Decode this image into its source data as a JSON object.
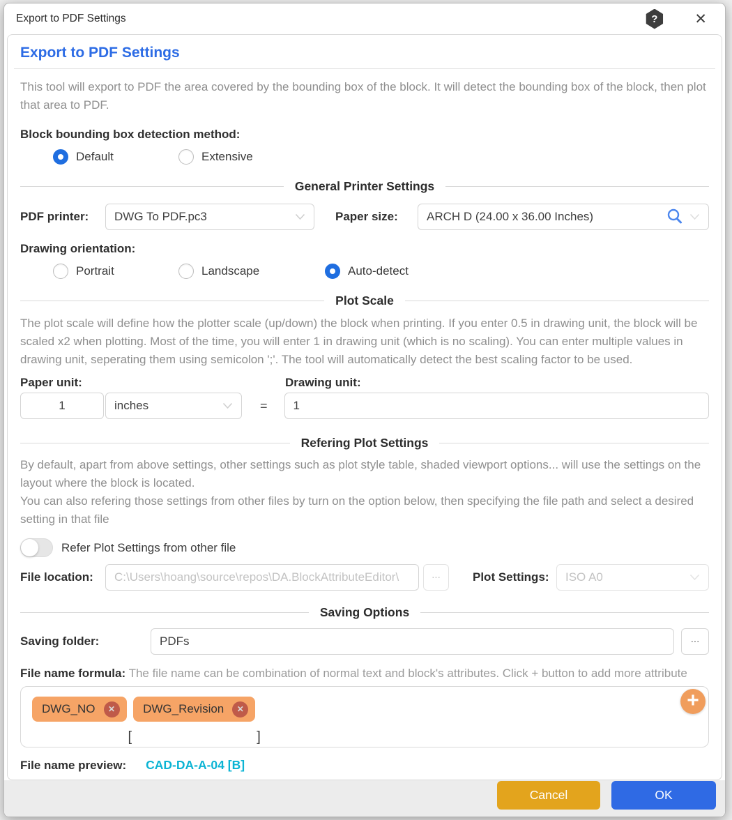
{
  "window": {
    "title": "Export to PDF Settings"
  },
  "header": {
    "title": "Export to PDF Settings"
  },
  "intro_text": "This tool will export to PDF the area covered by the bounding box of the block. It will detect the bounding box of the block, then plot that area to PDF.",
  "detection": {
    "label": "Block bounding box detection method:",
    "options": [
      {
        "label": "Default",
        "selected": true
      },
      {
        "label": "Extensive",
        "selected": false
      }
    ]
  },
  "printer_section": {
    "title": "General Printer Settings",
    "pdf_printer_label": "PDF printer:",
    "pdf_printer_value": "DWG To PDF.pc3",
    "paper_size_label": "Paper size:",
    "paper_size_value": "ARCH D (24.00 x 36.00 Inches)",
    "orientation_label": "Drawing orientation:",
    "orientation_options": [
      {
        "label": "Portrait",
        "selected": false
      },
      {
        "label": "Landscape",
        "selected": false
      },
      {
        "label": "Auto-detect",
        "selected": true
      }
    ]
  },
  "plot_scale": {
    "title": "Plot Scale",
    "description": "The plot scale will define how the plotter scale (up/down) the block when printing. If you enter 0.5 in drawing unit, the block will be scaled x2 when plotting. Most of the time, you will enter 1 in drawing unit (which is no scaling). You can enter multiple values in drawing unit, seperating them using semicolon ';'. The tool will automatically detect the best scaling factor to be used.",
    "paper_unit_label": "Paper unit:",
    "paper_unit_value": "1",
    "paper_unit_kind": "inches",
    "equals_sign": "=",
    "drawing_unit_label": "Drawing unit:",
    "drawing_unit_value": "1"
  },
  "refering_section": {
    "title": "Refering Plot Settings",
    "description1": "By default, apart from above settings, other settings such as plot style table, shaded viewport options... will use the settings on the layout where the block is located.",
    "description2": "You can also refering those settings from other files by turn on the option below, then specifying the file path and select a desired setting in that file",
    "toggle_label": "Refer Plot Settings from other file",
    "toggle_on": false,
    "file_location_label": "File location:",
    "file_location_value": "C:\\Users\\hoang\\source\\repos\\DA.BlockAttributeEditor\\",
    "browse_label": "...",
    "plot_settings_label": "Plot Settings:",
    "plot_settings_value": "ISO A0"
  },
  "saving_section": {
    "title": "Saving Options",
    "folder_label": "Saving folder:",
    "folder_value": "PDFs",
    "browse_label": "...",
    "formula_label": "File name formula:",
    "formula_hint": "The file name can be combination of normal text and block's attributes. Click + button to add more attribute",
    "chips": [
      {
        "label": "DWG_NO",
        "prefix": "",
        "suffix": ""
      },
      {
        "label": "DWG_Revision",
        "prefix": "[",
        "suffix": "]"
      }
    ],
    "add_button": "+",
    "preview_label": "File name preview:",
    "preview_value": "CAD-DA-A-04 [B]"
  },
  "footer": {
    "cancel_label": "Cancel",
    "ok_label": "OK"
  },
  "colors": {
    "accent_blue": "#2d6ce5",
    "radio_checked": "#1f6ee0",
    "chip_orange": "#f6a466",
    "chip_remove": "#bf5a49",
    "add_button_orange": "#f09d5c",
    "preview_teal": "#0cb4d4",
    "cancel_amber": "#e3a41d",
    "ok_blue": "#2f6ae4"
  }
}
